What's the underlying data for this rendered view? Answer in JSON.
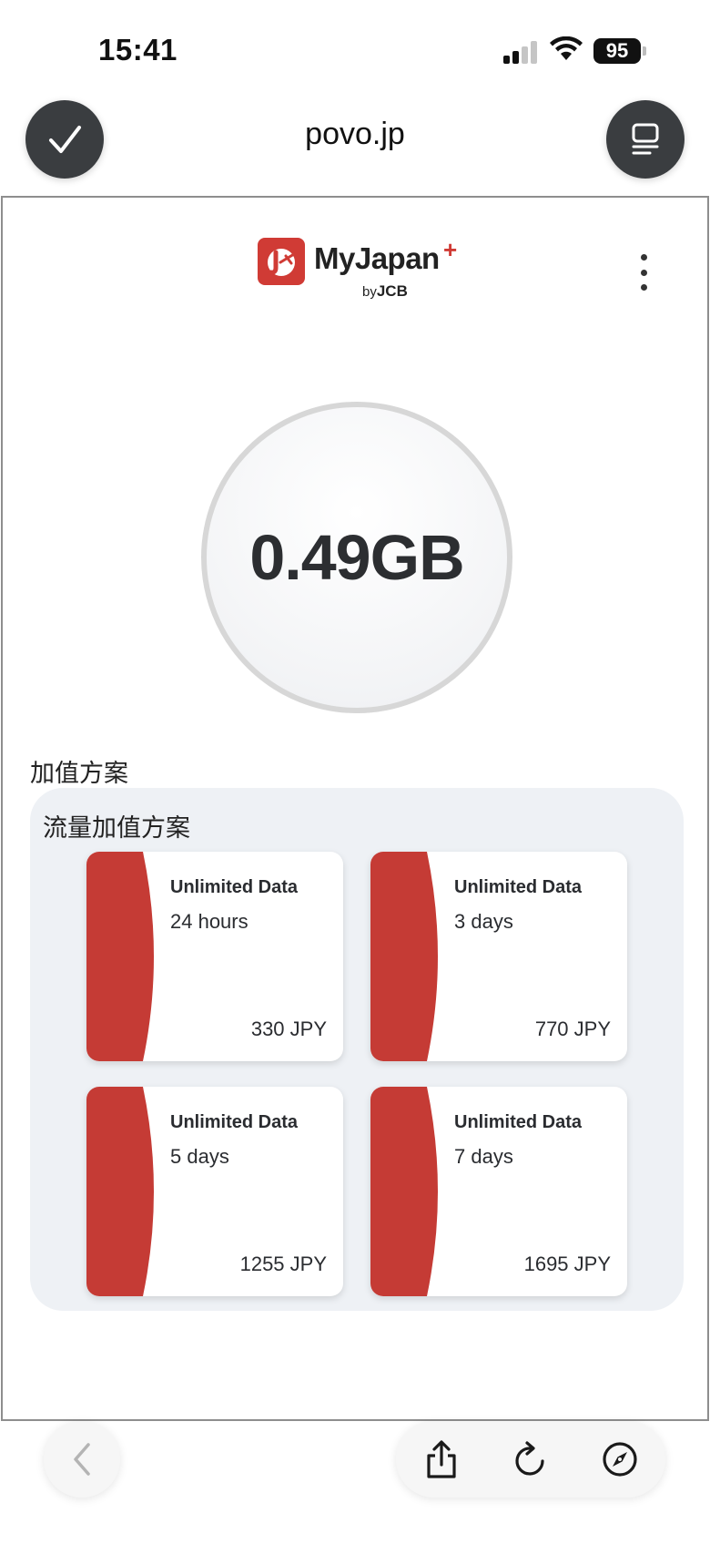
{
  "status_bar": {
    "time": "15:41",
    "battery": "95",
    "icons": [
      "cellular-signal-icon",
      "wifi-icon",
      "battery-icon"
    ]
  },
  "browser": {
    "url": "povo.jp",
    "left_button_icon": "checkmark-icon",
    "right_button_icon": "reader-icon"
  },
  "header": {
    "brand": "MyJapan",
    "brand_plus": "+",
    "brand_sub_prefix": "by",
    "brand_sub": "JCB",
    "menu_icon": "kebab-menu-icon"
  },
  "usage": {
    "remaining": "0.49GB"
  },
  "section": {
    "title": "加值方案",
    "panel_title": "流量加值方案"
  },
  "plans": [
    {
      "title": "Unlimited Data",
      "duration": "24 hours",
      "price": "330 JPY"
    },
    {
      "title": "Unlimited Data",
      "duration": "3 days",
      "price": "770 JPY"
    },
    {
      "title": "Unlimited Data",
      "duration": "5 days",
      "price": "1255 JPY"
    },
    {
      "title": "Unlimited Data",
      "duration": "7 days",
      "price": "1695 JPY"
    }
  ],
  "toolbar": {
    "icons": [
      "back-chevron-icon",
      "share-icon",
      "reload-icon",
      "compass-icon"
    ]
  },
  "colors": {
    "accent_red": "#c53b35",
    "panel_bg": "#eef1f5",
    "dark_button": "#3a3d40"
  }
}
